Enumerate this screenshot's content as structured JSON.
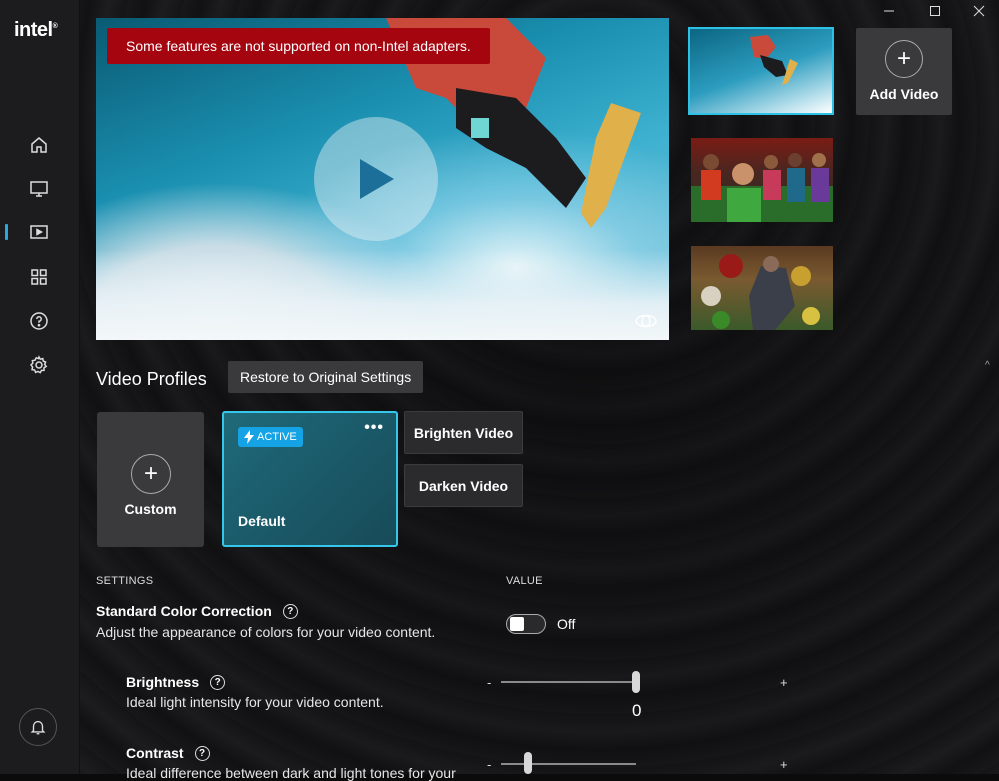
{
  "app": {
    "logo_text": "intel"
  },
  "sidebar": {
    "items": [
      {
        "icon": "home-icon"
      },
      {
        "icon": "display-icon"
      },
      {
        "icon": "video-icon",
        "active": true
      },
      {
        "icon": "apps-grid-icon"
      },
      {
        "icon": "help-icon"
      },
      {
        "icon": "gear-icon"
      }
    ],
    "bottom_icon": "bell-icon",
    "accent": "#2aa8e0"
  },
  "player": {
    "warning": "Some features are not supported on non-Intel adapters.",
    "warning_color": "#a4050f"
  },
  "thumbnails": [
    "snowboard",
    "group-of-people",
    "food-market"
  ],
  "add_video_label": "Add Video",
  "profiles": {
    "title": "Video Profiles",
    "restore_label": "Restore to Original Settings",
    "custom_label": "Custom",
    "active_badge": "ACTIVE",
    "active_name": "Default",
    "brighten_label": "Brighten Video",
    "darken_label": "Darken Video"
  },
  "settings": {
    "col_settings": "SETTINGS",
    "col_value": "VALUE",
    "color_correction": {
      "title": "Standard Color Correction",
      "desc": "Adjust the appearance of colors for your video content.",
      "state": "Off"
    },
    "brightness": {
      "title": "Brightness",
      "desc": "Ideal light intensity for your video content.",
      "value": "0",
      "fraction": 1.0
    },
    "contrast": {
      "title": "Contrast",
      "desc": "Ideal difference between dark and light tones for your",
      "fraction": 0.2
    },
    "minus": "-",
    "plus": "+"
  }
}
